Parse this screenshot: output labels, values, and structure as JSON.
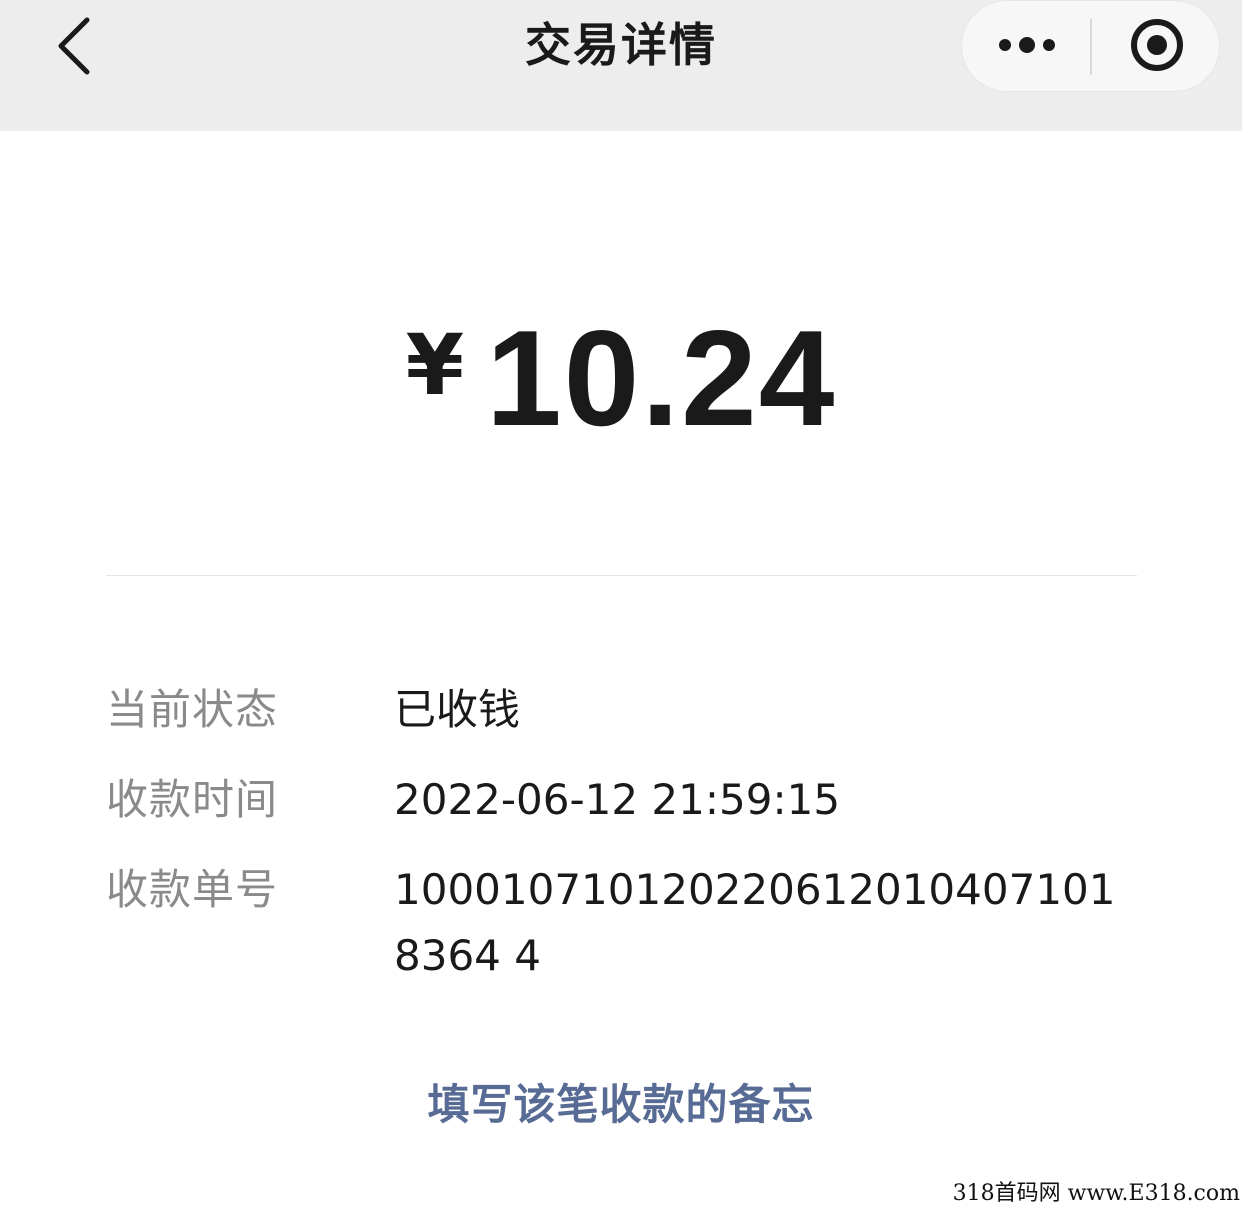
{
  "navbar": {
    "title": "交易详情",
    "back_icon": "chevron-left-icon",
    "more_icon": "more-dots-icon",
    "close_icon": "target-close-icon"
  },
  "amount": {
    "currency": "¥",
    "value": "10.24"
  },
  "details": [
    {
      "label": "当前状态",
      "value": "已收钱"
    },
    {
      "label": "收款时间",
      "value": "2022-06-12 21:59:15"
    },
    {
      "label": "收款单号",
      "value": "1000107101202206120104071018364 4"
    }
  ],
  "memo_link": "填写该笔收款的备忘",
  "watermark": "318首码网 www.E318.com",
  "colors": {
    "navbar_bg": "#ededed",
    "link": "#576b95",
    "label": "#8a8a8a",
    "text": "#1a1a1a"
  }
}
